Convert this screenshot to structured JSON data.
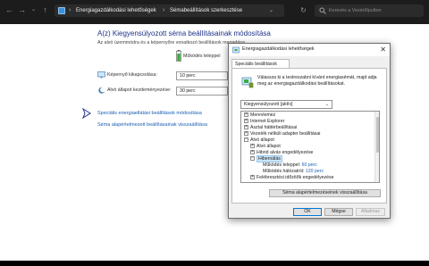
{
  "colors": {
    "title_blue": "#1e3287",
    "link_blue": "#1a5fb4",
    "header_bg": "#1c1c1c"
  },
  "address_bar": {
    "crumbs": [
      "Energiagazdálkodási lehetőségek",
      "Sémabeállítások szerkesztése"
    ]
  },
  "search": {
    "placeholder": "Keresés a Vezérlőpulton"
  },
  "main": {
    "title": "A(z) Kiegyensúlyozott séma beállításainak módosítása",
    "description": "Az alvó üzemmódra és a képernyőre vonatkozó beállítások megadása.",
    "column_header": "Működés teleppel",
    "display_label": "Képernyő kikapcsolása:",
    "display_value": "10 perc",
    "sleep_label": "Alvó állapot kezdeményezése:",
    "sleep_value": "30 perc",
    "advanced_link": "Speciális energiaellátási beállítások módosítása",
    "restore_link": "Séma alapértelmezett beállításainak visszaállítása"
  },
  "dialog": {
    "title": "Energiagazdálkodási lehetőségek",
    "close_glyph": "✕",
    "tab": "Speciális beállítások",
    "description": "Válassza ki a testreszabni kívánt energiasémát, majd adja meg az energiagazdálkodási beállításokat.",
    "plan_selected": "Kiegyensúlyozott [aktív]",
    "tree": [
      {
        "label": "Merevlemez",
        "expander": "+"
      },
      {
        "label": "Internet Explorer",
        "expander": "+"
      },
      {
        "label": "Asztal háttérbeállításai",
        "expander": "+"
      },
      {
        "label": "Vezeték nélküli adapter beállításai",
        "expander": "+"
      },
      {
        "label": "Alvó állapot",
        "expander": "−"
      },
      {
        "label": "Alvó állapot",
        "expander": "+"
      },
      {
        "label": "Hibrid alvás engedélyezése",
        "expander": "+"
      },
      {
        "label": "Hibernálás",
        "expander": "−"
      },
      {
        "label": "Működés teleppel:",
        "value": "60 perc"
      },
      {
        "label": "Működés hálózatról:",
        "value": "120 perc"
      },
      {
        "label": "Felébresztési időzítők engedélyezése",
        "expander": "+"
      }
    ],
    "restore_button": "Séma alapértelmezéseinek visszaállítása",
    "ok": "OK",
    "cancel": "Mégse",
    "apply": "Alkalmaz"
  }
}
